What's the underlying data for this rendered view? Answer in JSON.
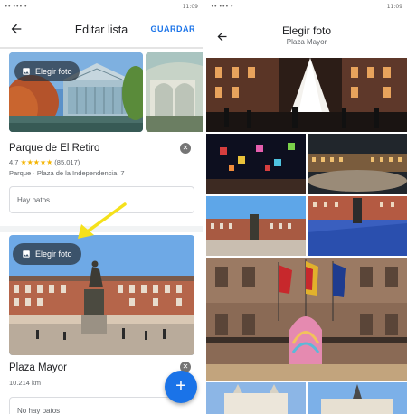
{
  "left_screen": {
    "status": {
      "left": "•• ••• •",
      "right": "11:09"
    },
    "appbar": {
      "title": "Editar lista",
      "save_label": "GUARDAR"
    },
    "places": [
      {
        "name": "Parque de El Retiro",
        "rating": "4,7",
        "stars": "★★★★★",
        "reviews": "(85.017)",
        "address": "Parque · Plaza de la Independencia, 7",
        "note": "Hay patos",
        "choose_photo": "Elegir foto"
      },
      {
        "name": "Plaza Mayor",
        "meta": "10.214 km",
        "note": "No hay patos",
        "choose_photo": "Elegir foto"
      }
    ],
    "fab_label": "+"
  },
  "right_screen": {
    "status": {
      "left": "•• ••• •",
      "right": "11:09"
    },
    "title": "Elegir foto",
    "subtitle": "Plaza Mayor"
  },
  "colors": {
    "accent": "#1a73e8",
    "star": "#f4b400",
    "arrow": "#f5e11b"
  }
}
